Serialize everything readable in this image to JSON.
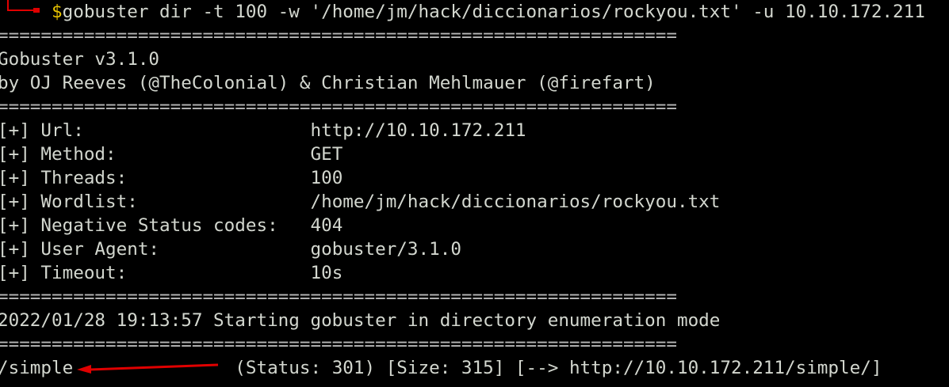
{
  "command": {
    "prompt_symbol": "$",
    "text": "gobuster dir -t 100 -w '/home/jm/hack/diccionarios/rockyou.txt' -u 10.10.172.211"
  },
  "separator": "===============================================================",
  "banner": [
    "Gobuster v3.1.0",
    "by OJ Reeves (@TheColonial) & Christian Mehlmauer (@firefart)"
  ],
  "config": [
    {
      "label": "[+] Url:                     ",
      "value": "http://10.10.172.211"
    },
    {
      "label": "[+] Method:                  ",
      "value": "GET"
    },
    {
      "label": "[+] Threads:                 ",
      "value": "100"
    },
    {
      "label": "[+] Wordlist:                ",
      "value": "/home/jm/hack/diccionarios/rockyou.txt"
    },
    {
      "label": "[+] Negative Status codes:   ",
      "value": "404"
    },
    {
      "label": "[+] User Agent:              ",
      "value": "gobuster/3.1.0"
    },
    {
      "label": "[+] Timeout:                 ",
      "value": "10s"
    }
  ],
  "start_message": "2022/01/28 19:13:57 Starting gobuster in directory enumeration mode",
  "result": {
    "path": "/simple",
    "details": "(Status: 301) [Size: 315] [--> http://10.10.172.211/simple/]"
  },
  "colors": {
    "annotation_arrow": "#e00000",
    "prompt": "#e5c100"
  }
}
